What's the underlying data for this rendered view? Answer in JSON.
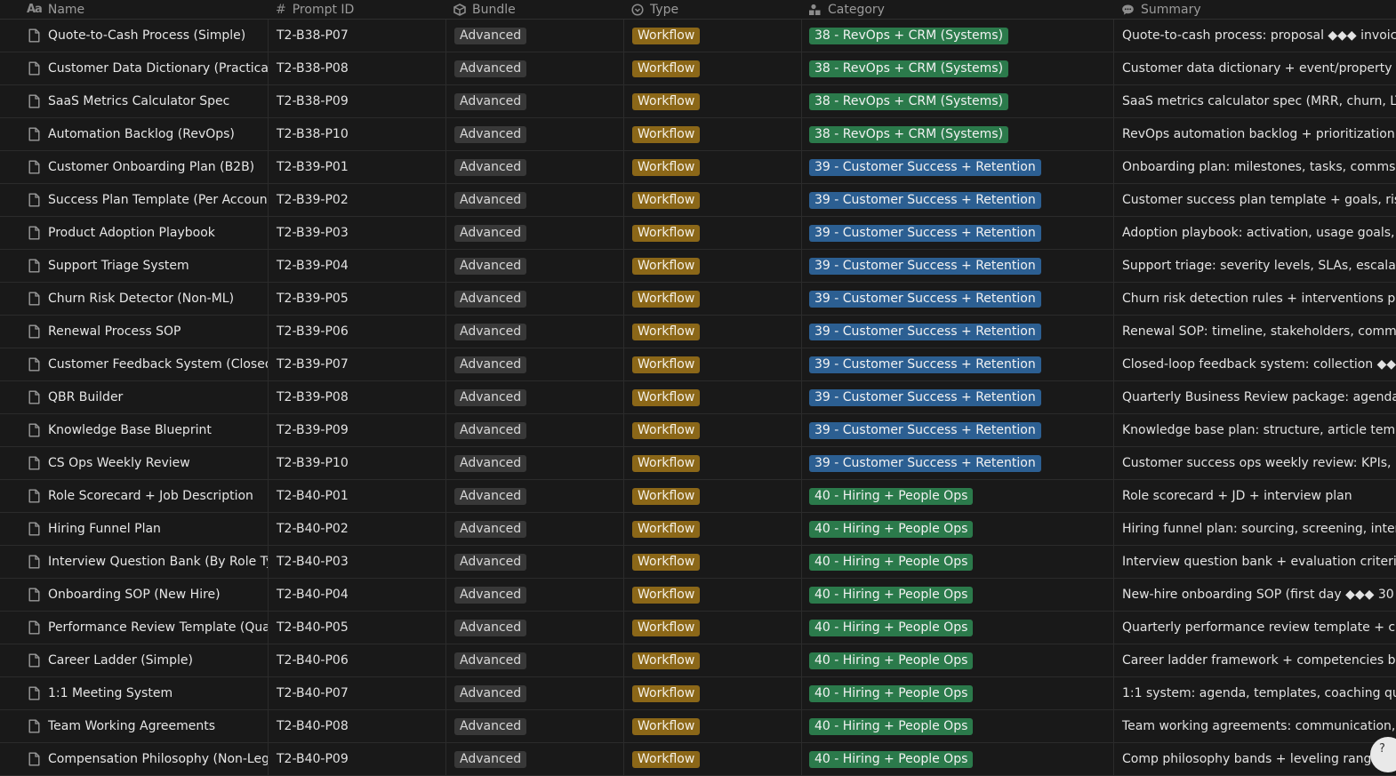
{
  "columns": {
    "name": "Name",
    "prompt_id": "Prompt ID",
    "bundle": "Bundle",
    "type": "Type",
    "category": "Category",
    "summary": "Summary"
  },
  "colors": {
    "38 - RevOps + CRM (Systems)": "#2b7a4b",
    "39 - Customer Success + Retention": "#2c5f92",
    "40 - Hiring + People Ops": "#2b7a4b"
  },
  "rows": [
    {
      "name": "Quote-to-Cash Process (Simple)",
      "id": "T2-B38-P07",
      "bundle": "Advanced",
      "type": "Workflow",
      "category": "38 - RevOps + CRM (Systems)",
      "summary": "Quote-to-cash process: proposal ◆◆◆ invoice"
    },
    {
      "name": "Customer Data Dictionary (Practical)",
      "id": "T2-B38-P08",
      "bundle": "Advanced",
      "type": "Workflow",
      "category": "38 - RevOps + CRM (Systems)",
      "summary": "Customer data dictionary + event/property naming"
    },
    {
      "name": "SaaS Metrics Calculator Spec",
      "id": "T2-B38-P09",
      "bundle": "Advanced",
      "type": "Workflow",
      "category": "38 - RevOps + CRM (Systems)",
      "summary": "SaaS metrics calculator spec (MRR, churn, LTV"
    },
    {
      "name": "Automation Backlog (RevOps)",
      "id": "T2-B38-P10",
      "bundle": "Advanced",
      "type": "Workflow",
      "category": "38 - RevOps + CRM (Systems)",
      "summary": "RevOps automation backlog + prioritization + im"
    },
    {
      "name": "Customer Onboarding Plan (B2B)",
      "id": "T2-B39-P01",
      "bundle": "Advanced",
      "type": "Workflow",
      "category": "39 - Customer Success + Retention",
      "summary": "Onboarding plan: milestones, tasks, comms, su"
    },
    {
      "name": "Success Plan Template (Per Account)",
      "id": "T2-B39-P02",
      "bundle": "Advanced",
      "type": "Workflow",
      "category": "39 - Customer Success + Retention",
      "summary": "Customer success plan template + goals, risks"
    },
    {
      "name": "Product Adoption Playbook",
      "id": "T2-B39-P03",
      "bundle": "Advanced",
      "type": "Workflow",
      "category": "39 - Customer Success + Retention",
      "summary": "Adoption playbook: activation, usage goals, nu"
    },
    {
      "name": "Support Triage System",
      "id": "T2-B39-P04",
      "bundle": "Advanced",
      "type": "Workflow",
      "category": "39 - Customer Success + Retention",
      "summary": "Support triage: severity levels, SLAs, escalation"
    },
    {
      "name": "Churn Risk Detector (Non-ML)",
      "id": "T2-B39-P05",
      "bundle": "Advanced",
      "type": "Workflow",
      "category": "39 - Customer Success + Retention",
      "summary": "Churn risk detection rules + interventions play"
    },
    {
      "name": "Renewal Process SOP",
      "id": "T2-B39-P06",
      "bundle": "Advanced",
      "type": "Workflow",
      "category": "39 - Customer Success + Retention",
      "summary": "Renewal SOP: timeline, stakeholders, comms,"
    },
    {
      "name": "Customer Feedback System (Closed Loop)",
      "id": "T2-B39-P07",
      "bundle": "Advanced",
      "type": "Workflow",
      "category": "39 - Customer Success + Retention",
      "summary": "Closed-loop feedback system: collection ◆◆◆"
    },
    {
      "name": "QBR Builder",
      "id": "T2-B39-P08",
      "bundle": "Advanced",
      "type": "Workflow",
      "category": "39 - Customer Success + Retention",
      "summary": "Quarterly Business Review package: agenda, s"
    },
    {
      "name": "Knowledge Base Blueprint",
      "id": "T2-B39-P09",
      "bundle": "Advanced",
      "type": "Workflow",
      "category": "39 - Customer Success + Retention",
      "summary": "Knowledge base plan: structure, article templa"
    },
    {
      "name": "CS Ops Weekly Review",
      "id": "T2-B39-P10",
      "bundle": "Advanced",
      "type": "Workflow",
      "category": "39 - Customer Success + Retention",
      "summary": "Customer success ops weekly review: KPIs, ris"
    },
    {
      "name": "Role Scorecard + Job Description",
      "id": "T2-B40-P01",
      "bundle": "Advanced",
      "type": "Workflow",
      "category": "40 - Hiring + People Ops",
      "summary": "Role scorecard + JD + interview plan"
    },
    {
      "name": "Hiring Funnel Plan",
      "id": "T2-B40-P02",
      "bundle": "Advanced",
      "type": "Workflow",
      "category": "40 - Hiring + People Ops",
      "summary": "Hiring funnel plan: sourcing, screening, intervie"
    },
    {
      "name": "Interview Question Bank (By Role Type)",
      "id": "T2-B40-P03",
      "bundle": "Advanced",
      "type": "Workflow",
      "category": "40 - Hiring + People Ops",
      "summary": "Interview question bank + evaluation criteria"
    },
    {
      "name": "Onboarding SOP (New Hire)",
      "id": "T2-B40-P04",
      "bundle": "Advanced",
      "type": "Workflow",
      "category": "40 - Hiring + People Ops",
      "summary": "New-hire onboarding SOP (first day ◆◆◆ 30"
    },
    {
      "name": "Performance Review Template (Quarterly)",
      "id": "T2-B40-P05",
      "bundle": "Advanced",
      "type": "Workflow",
      "category": "40 - Hiring + People Ops",
      "summary": "Quarterly performance review template + calib"
    },
    {
      "name": "Career Ladder (Simple)",
      "id": "T2-B40-P06",
      "bundle": "Advanced",
      "type": "Workflow",
      "category": "40 - Hiring + People Ops",
      "summary": "Career ladder framework + competencies by le"
    },
    {
      "name": "1:1 Meeting System",
      "id": "T2-B40-P07",
      "bundle": "Advanced",
      "type": "Workflow",
      "category": "40 - Hiring + People Ops",
      "summary": "1:1 system: agenda, templates, coaching ques"
    },
    {
      "name": "Team Working Agreements",
      "id": "T2-B40-P08",
      "bundle": "Advanced",
      "type": "Workflow",
      "category": "40 - Hiring + People Ops",
      "summary": "Team working agreements: communication, as"
    },
    {
      "name": "Compensation Philosophy (Non-Legal)",
      "id": "T2-B40-P09",
      "bundle": "Advanced",
      "type": "Workflow",
      "category": "40 - Hiring + People Ops",
      "summary": "Comp philosophy bands + leveling ranges"
    }
  ],
  "corner_badge": "?"
}
